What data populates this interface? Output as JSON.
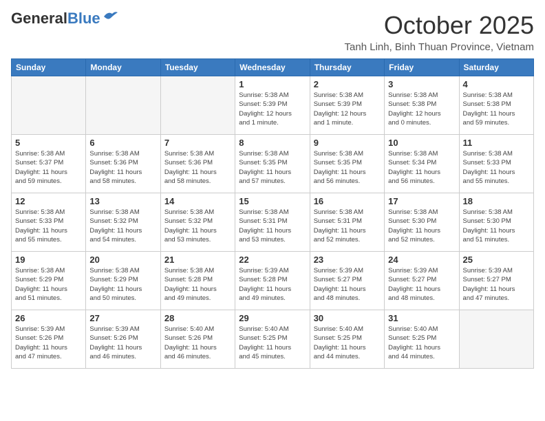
{
  "header": {
    "logo_general": "General",
    "logo_blue": "Blue",
    "month": "October 2025",
    "location": "Tanh Linh, Binh Thuan Province, Vietnam"
  },
  "weekdays": [
    "Sunday",
    "Monday",
    "Tuesday",
    "Wednesday",
    "Thursday",
    "Friday",
    "Saturday"
  ],
  "weeks": [
    [
      {
        "day": "",
        "info": ""
      },
      {
        "day": "",
        "info": ""
      },
      {
        "day": "",
        "info": ""
      },
      {
        "day": "1",
        "info": "Sunrise: 5:38 AM\nSunset: 5:39 PM\nDaylight: 12 hours\nand 1 minute."
      },
      {
        "day": "2",
        "info": "Sunrise: 5:38 AM\nSunset: 5:39 PM\nDaylight: 12 hours\nand 1 minute."
      },
      {
        "day": "3",
        "info": "Sunrise: 5:38 AM\nSunset: 5:38 PM\nDaylight: 12 hours\nand 0 minutes."
      },
      {
        "day": "4",
        "info": "Sunrise: 5:38 AM\nSunset: 5:38 PM\nDaylight: 11 hours\nand 59 minutes."
      }
    ],
    [
      {
        "day": "5",
        "info": "Sunrise: 5:38 AM\nSunset: 5:37 PM\nDaylight: 11 hours\nand 59 minutes."
      },
      {
        "day": "6",
        "info": "Sunrise: 5:38 AM\nSunset: 5:36 PM\nDaylight: 11 hours\nand 58 minutes."
      },
      {
        "day": "7",
        "info": "Sunrise: 5:38 AM\nSunset: 5:36 PM\nDaylight: 11 hours\nand 58 minutes."
      },
      {
        "day": "8",
        "info": "Sunrise: 5:38 AM\nSunset: 5:35 PM\nDaylight: 11 hours\nand 57 minutes."
      },
      {
        "day": "9",
        "info": "Sunrise: 5:38 AM\nSunset: 5:35 PM\nDaylight: 11 hours\nand 56 minutes."
      },
      {
        "day": "10",
        "info": "Sunrise: 5:38 AM\nSunset: 5:34 PM\nDaylight: 11 hours\nand 56 minutes."
      },
      {
        "day": "11",
        "info": "Sunrise: 5:38 AM\nSunset: 5:33 PM\nDaylight: 11 hours\nand 55 minutes."
      }
    ],
    [
      {
        "day": "12",
        "info": "Sunrise: 5:38 AM\nSunset: 5:33 PM\nDaylight: 11 hours\nand 55 minutes."
      },
      {
        "day": "13",
        "info": "Sunrise: 5:38 AM\nSunset: 5:32 PM\nDaylight: 11 hours\nand 54 minutes."
      },
      {
        "day": "14",
        "info": "Sunrise: 5:38 AM\nSunset: 5:32 PM\nDaylight: 11 hours\nand 53 minutes."
      },
      {
        "day": "15",
        "info": "Sunrise: 5:38 AM\nSunset: 5:31 PM\nDaylight: 11 hours\nand 53 minutes."
      },
      {
        "day": "16",
        "info": "Sunrise: 5:38 AM\nSunset: 5:31 PM\nDaylight: 11 hours\nand 52 minutes."
      },
      {
        "day": "17",
        "info": "Sunrise: 5:38 AM\nSunset: 5:30 PM\nDaylight: 11 hours\nand 52 minutes."
      },
      {
        "day": "18",
        "info": "Sunrise: 5:38 AM\nSunset: 5:30 PM\nDaylight: 11 hours\nand 51 minutes."
      }
    ],
    [
      {
        "day": "19",
        "info": "Sunrise: 5:38 AM\nSunset: 5:29 PM\nDaylight: 11 hours\nand 51 minutes."
      },
      {
        "day": "20",
        "info": "Sunrise: 5:38 AM\nSunset: 5:29 PM\nDaylight: 11 hours\nand 50 minutes."
      },
      {
        "day": "21",
        "info": "Sunrise: 5:38 AM\nSunset: 5:28 PM\nDaylight: 11 hours\nand 49 minutes."
      },
      {
        "day": "22",
        "info": "Sunrise: 5:39 AM\nSunset: 5:28 PM\nDaylight: 11 hours\nand 49 minutes."
      },
      {
        "day": "23",
        "info": "Sunrise: 5:39 AM\nSunset: 5:27 PM\nDaylight: 11 hours\nand 48 minutes."
      },
      {
        "day": "24",
        "info": "Sunrise: 5:39 AM\nSunset: 5:27 PM\nDaylight: 11 hours\nand 48 minutes."
      },
      {
        "day": "25",
        "info": "Sunrise: 5:39 AM\nSunset: 5:27 PM\nDaylight: 11 hours\nand 47 minutes."
      }
    ],
    [
      {
        "day": "26",
        "info": "Sunrise: 5:39 AM\nSunset: 5:26 PM\nDaylight: 11 hours\nand 47 minutes."
      },
      {
        "day": "27",
        "info": "Sunrise: 5:39 AM\nSunset: 5:26 PM\nDaylight: 11 hours\nand 46 minutes."
      },
      {
        "day": "28",
        "info": "Sunrise: 5:40 AM\nSunset: 5:26 PM\nDaylight: 11 hours\nand 46 minutes."
      },
      {
        "day": "29",
        "info": "Sunrise: 5:40 AM\nSunset: 5:25 PM\nDaylight: 11 hours\nand 45 minutes."
      },
      {
        "day": "30",
        "info": "Sunrise: 5:40 AM\nSunset: 5:25 PM\nDaylight: 11 hours\nand 44 minutes."
      },
      {
        "day": "31",
        "info": "Sunrise: 5:40 AM\nSunset: 5:25 PM\nDaylight: 11 hours\nand 44 minutes."
      },
      {
        "day": "",
        "info": ""
      }
    ]
  ]
}
